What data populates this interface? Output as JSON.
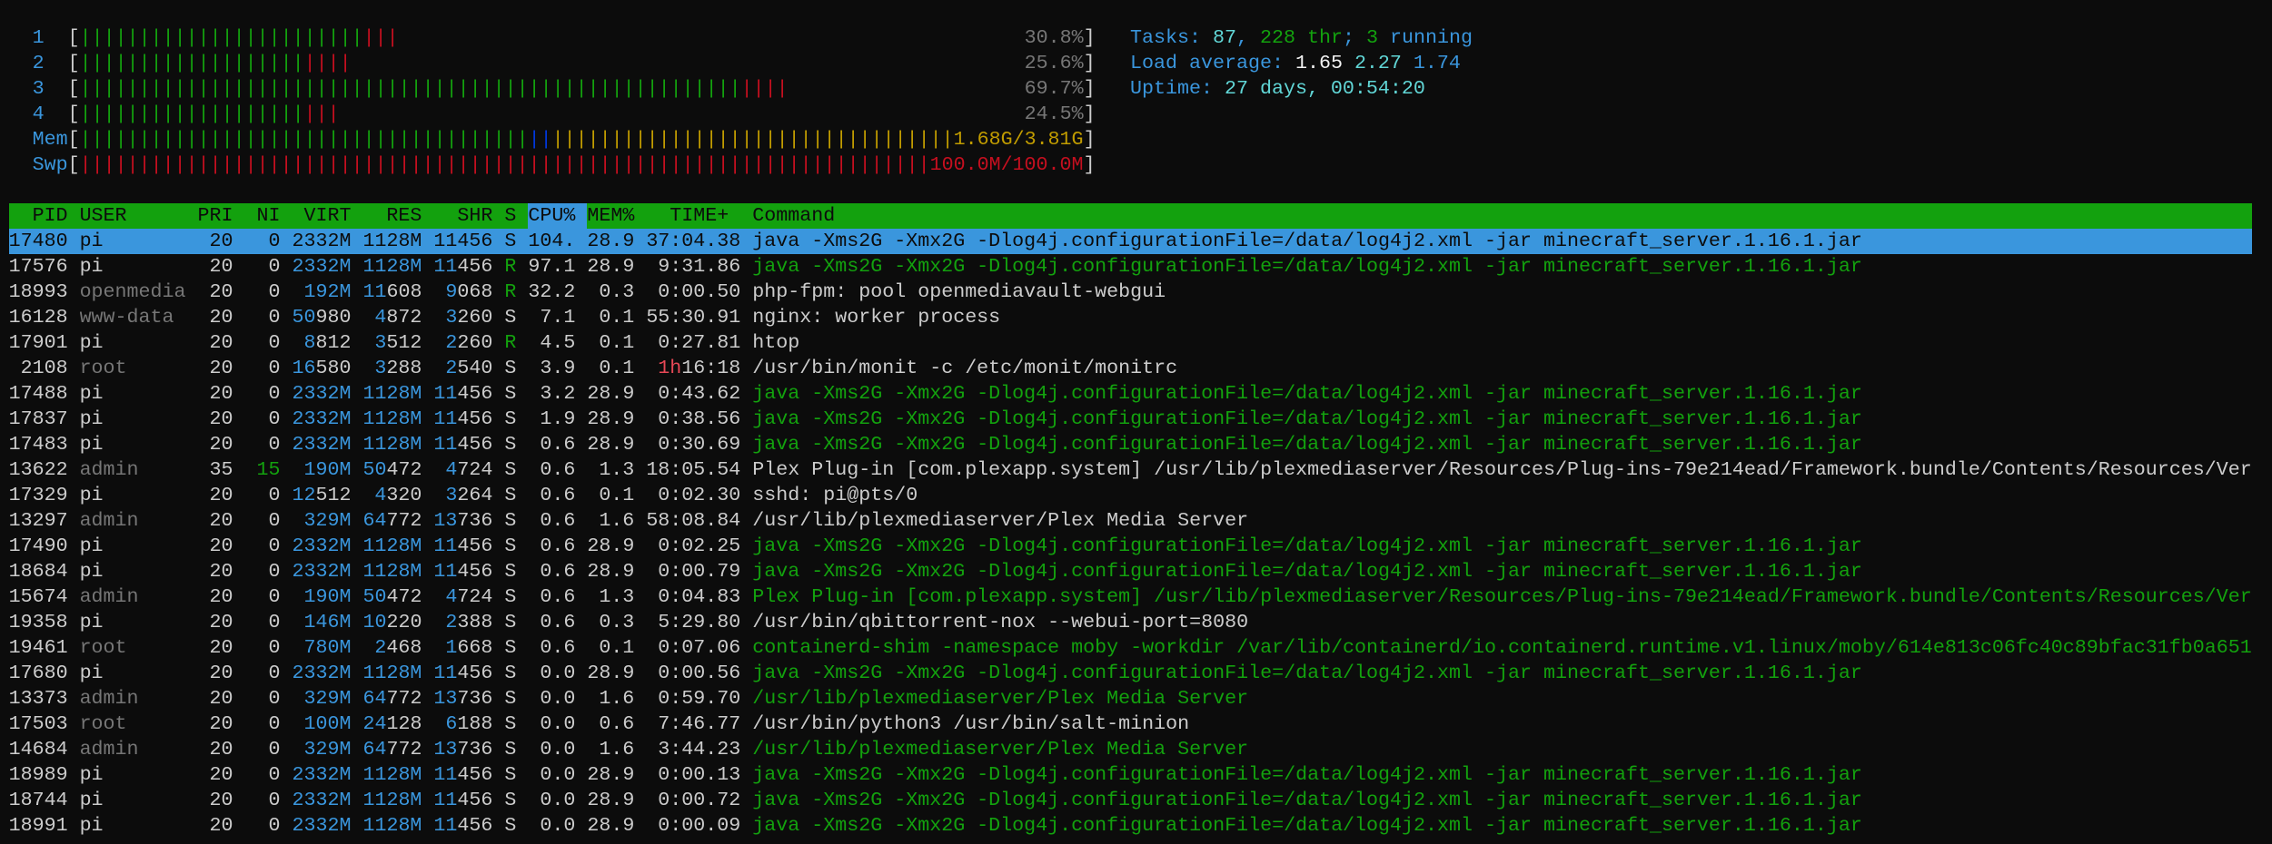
{
  "colors": {
    "green": "#13a10e",
    "red": "#c50f1f",
    "blue": "#3a96dd",
    "dark_blue": "#0037da",
    "yellow": "#c19c00",
    "cyan": "#61d6d6",
    "background": "#0c0c0c"
  },
  "meters": {
    "cpus": [
      {
        "label": "1",
        "value_text": "30.8%",
        "normal_pct": 28.2,
        "kernel_pct": 3.5
      },
      {
        "label": "2",
        "value_text": "25.6%",
        "normal_pct": 22.4,
        "kernel_pct": 4.7
      },
      {
        "label": "3",
        "value_text": "69.7%",
        "normal_pct": 65.9,
        "kernel_pct": 4.7
      },
      {
        "label": "4",
        "value_text": "24.5%",
        "normal_pct": 22.4,
        "kernel_pct": 3.5
      }
    ],
    "mem": {
      "label": "Mem",
      "value_text": "1.68G/3.81G",
      "used_pct": 44.7,
      "buffers_pct": 2.4,
      "cache_pct": 40.0
    },
    "swap": {
      "label": "Swp",
      "value_text": "100.0M/100.0M",
      "used_pct": 100
    }
  },
  "info": {
    "tasks_label": "Tasks: ",
    "tasks": "87",
    "sep1": ", ",
    "threads": "228",
    "thr_label": " thr",
    "sep2": "; ",
    "running": "3",
    "running_label": " running",
    "load_label": "Load average: ",
    "load1": "1.65",
    "load5": "2.27",
    "load15": "1.74",
    "uptime_label": "Uptime: ",
    "uptime": "27 days, 00:54:20"
  },
  "table": {
    "headers": {
      "pid": "PID",
      "user": "USER",
      "pri": "PRI",
      "ni": "NI",
      "virt": "VIRT",
      "res": "RES",
      "shr": "SHR",
      "s": "S",
      "cpu": "CPU%",
      "mem": "MEM%",
      "time": "TIME+",
      "command": "Command"
    },
    "sort_column": "cpu",
    "selected_index": 0,
    "rows": [
      {
        "pid": "17480",
        "user": "pi",
        "pri": "20",
        "ni": "0",
        "virt": "2332M",
        "res": "1128M",
        "shr": "11456",
        "s": "S",
        "cpu": "104.",
        "mem": "28.9",
        "time": "37:04.38",
        "command": "java -Xms2G -Xmx2G -Dlog4j.configurationFile=/data/log4j2.xml -jar minecraft_server.1.16.1.jar",
        "thread": false
      },
      {
        "pid": "17576",
        "user": "pi",
        "pri": "20",
        "ni": "0",
        "virt": "2332M",
        "res": "1128M",
        "shr": "11456",
        "s": "R",
        "cpu": "97.1",
        "mem": "28.9",
        "time": "9:31.86",
        "command": "java -Xms2G -Xmx2G -Dlog4j.configurationFile=/data/log4j2.xml -jar minecraft_server.1.16.1.jar",
        "thread": true
      },
      {
        "pid": "18993",
        "user": "openmedia",
        "pri": "20",
        "ni": "0",
        "virt": "192M",
        "res": "11608",
        "shr": "9068",
        "s": "R",
        "cpu": "32.2",
        "mem": "0.3",
        "time": "0:00.50",
        "command": "php-fpm: pool openmediavault-webgui",
        "thread": false
      },
      {
        "pid": "16128",
        "user": "www-data",
        "pri": "20",
        "ni": "0",
        "virt": "50980",
        "res": "4872",
        "shr": "3260",
        "s": "S",
        "cpu": "7.1",
        "mem": "0.1",
        "time": "55:30.91",
        "command": "nginx: worker process",
        "thread": false
      },
      {
        "pid": "17901",
        "user": "pi",
        "pri": "20",
        "ni": "0",
        "virt": "8812",
        "res": "3512",
        "shr": "2260",
        "s": "R",
        "cpu": "4.5",
        "mem": "0.1",
        "time": "0:27.81",
        "command": "htop",
        "thread": false
      },
      {
        "pid": "2108",
        "user": "root",
        "pri": "20",
        "ni": "0",
        "virt": "16580",
        "res": "3288",
        "shr": "2540",
        "s": "S",
        "cpu": "3.9",
        "mem": "0.1",
        "time": "1h16:18",
        "command": "/usr/bin/monit -c /etc/monit/monitrc",
        "thread": false
      },
      {
        "pid": "17488",
        "user": "pi",
        "pri": "20",
        "ni": "0",
        "virt": "2332M",
        "res": "1128M",
        "shr": "11456",
        "s": "S",
        "cpu": "3.2",
        "mem": "28.9",
        "time": "0:43.62",
        "command": "java -Xms2G -Xmx2G -Dlog4j.configurationFile=/data/log4j2.xml -jar minecraft_server.1.16.1.jar",
        "thread": true
      },
      {
        "pid": "17837",
        "user": "pi",
        "pri": "20",
        "ni": "0",
        "virt": "2332M",
        "res": "1128M",
        "shr": "11456",
        "s": "S",
        "cpu": "1.9",
        "mem": "28.9",
        "time": "0:38.56",
        "command": "java -Xms2G -Xmx2G -Dlog4j.configurationFile=/data/log4j2.xml -jar minecraft_server.1.16.1.jar",
        "thread": true
      },
      {
        "pid": "17483",
        "user": "pi",
        "pri": "20",
        "ni": "0",
        "virt": "2332M",
        "res": "1128M",
        "shr": "11456",
        "s": "S",
        "cpu": "0.6",
        "mem": "28.9",
        "time": "0:30.69",
        "command": "java -Xms2G -Xmx2G -Dlog4j.configurationFile=/data/log4j2.xml -jar minecraft_server.1.16.1.jar",
        "thread": true
      },
      {
        "pid": "13622",
        "user": "admin",
        "pri": "35",
        "ni": "15",
        "virt": "190M",
        "res": "50472",
        "shr": "4724",
        "s": "S",
        "cpu": "0.6",
        "mem": "1.3",
        "time": "18:05.54",
        "command": "Plex Plug-in [com.plexapp.system] /usr/lib/plexmediaserver/Resources/Plug-ins-79e214ead/Framework.bundle/Contents/Resources/Ver",
        "thread": false
      },
      {
        "pid": "17329",
        "user": "pi",
        "pri": "20",
        "ni": "0",
        "virt": "12512",
        "res": "4320",
        "shr": "3264",
        "s": "S",
        "cpu": "0.6",
        "mem": "0.1",
        "time": "0:02.30",
        "command": "sshd: pi@pts/0",
        "thread": false
      },
      {
        "pid": "13297",
        "user": "admin",
        "pri": "20",
        "ni": "0",
        "virt": "329M",
        "res": "64772",
        "shr": "13736",
        "s": "S",
        "cpu": "0.6",
        "mem": "1.6",
        "time": "58:08.84",
        "command": "/usr/lib/plexmediaserver/Plex Media Server",
        "thread": false
      },
      {
        "pid": "17490",
        "user": "pi",
        "pri": "20",
        "ni": "0",
        "virt": "2332M",
        "res": "1128M",
        "shr": "11456",
        "s": "S",
        "cpu": "0.6",
        "mem": "28.9",
        "time": "0:02.25",
        "command": "java -Xms2G -Xmx2G -Dlog4j.configurationFile=/data/log4j2.xml -jar minecraft_server.1.16.1.jar",
        "thread": true
      },
      {
        "pid": "18684",
        "user": "pi",
        "pri": "20",
        "ni": "0",
        "virt": "2332M",
        "res": "1128M",
        "shr": "11456",
        "s": "S",
        "cpu": "0.6",
        "mem": "28.9",
        "time": "0:00.79",
        "command": "java -Xms2G -Xmx2G -Dlog4j.configurationFile=/data/log4j2.xml -jar minecraft_server.1.16.1.jar",
        "thread": true
      },
      {
        "pid": "15674",
        "user": "admin",
        "pri": "20",
        "ni": "0",
        "virt": "190M",
        "res": "50472",
        "shr": "4724",
        "s": "S",
        "cpu": "0.6",
        "mem": "1.3",
        "time": "0:04.83",
        "command": "Plex Plug-in [com.plexapp.system] /usr/lib/plexmediaserver/Resources/Plug-ins-79e214ead/Framework.bundle/Contents/Resources/Ver",
        "thread": true
      },
      {
        "pid": "19358",
        "user": "pi",
        "pri": "20",
        "ni": "0",
        "virt": "146M",
        "res": "10220",
        "shr": "2388",
        "s": "S",
        "cpu": "0.6",
        "mem": "0.3",
        "time": "5:29.80",
        "command": "/usr/bin/qbittorrent-nox --webui-port=8080",
        "thread": false
      },
      {
        "pid": "19461",
        "user": "root",
        "pri": "20",
        "ni": "0",
        "virt": "780M",
        "res": "2468",
        "shr": "1668",
        "s": "S",
        "cpu": "0.6",
        "mem": "0.1",
        "time": "0:07.06",
        "command": "containerd-shim -namespace moby -workdir /var/lib/containerd/io.containerd.runtime.v1.linux/moby/614e813c06fc40c89bfac31fb0a651",
        "thread": true
      },
      {
        "pid": "17680",
        "user": "pi",
        "pri": "20",
        "ni": "0",
        "virt": "2332M",
        "res": "1128M",
        "shr": "11456",
        "s": "S",
        "cpu": "0.0",
        "mem": "28.9",
        "time": "0:00.56",
        "command": "java -Xms2G -Xmx2G -Dlog4j.configurationFile=/data/log4j2.xml -jar minecraft_server.1.16.1.jar",
        "thread": true
      },
      {
        "pid": "13373",
        "user": "admin",
        "pri": "20",
        "ni": "0",
        "virt": "329M",
        "res": "64772",
        "shr": "13736",
        "s": "S",
        "cpu": "0.0",
        "mem": "1.6",
        "time": "0:59.70",
        "command": "/usr/lib/plexmediaserver/Plex Media Server",
        "thread": true
      },
      {
        "pid": "17503",
        "user": "root",
        "pri": "20",
        "ni": "0",
        "virt": "100M",
        "res": "24128",
        "shr": "6188",
        "s": "S",
        "cpu": "0.0",
        "mem": "0.6",
        "time": "7:46.77",
        "command": "/usr/bin/python3 /usr/bin/salt-minion",
        "thread": false
      },
      {
        "pid": "14684",
        "user": "admin",
        "pri": "20",
        "ni": "0",
        "virt": "329M",
        "res": "64772",
        "shr": "13736",
        "s": "S",
        "cpu": "0.0",
        "mem": "1.6",
        "time": "3:44.23",
        "command": "/usr/lib/plexmediaserver/Plex Media Server",
        "thread": true
      },
      {
        "pid": "18989",
        "user": "pi",
        "pri": "20",
        "ni": "0",
        "virt": "2332M",
        "res": "1128M",
        "shr": "11456",
        "s": "S",
        "cpu": "0.0",
        "mem": "28.9",
        "time": "0:00.13",
        "command": "java -Xms2G -Xmx2G -Dlog4j.configurationFile=/data/log4j2.xml -jar minecraft_server.1.16.1.jar",
        "thread": true
      },
      {
        "pid": "18744",
        "user": "pi",
        "pri": "20",
        "ni": "0",
        "virt": "2332M",
        "res": "1128M",
        "shr": "11456",
        "s": "S",
        "cpu": "0.0",
        "mem": "28.9",
        "time": "0:00.72",
        "command": "java -Xms2G -Xmx2G -Dlog4j.configurationFile=/data/log4j2.xml -jar minecraft_server.1.16.1.jar",
        "thread": true
      },
      {
        "pid": "18991",
        "user": "pi",
        "pri": "20",
        "ni": "0",
        "virt": "2332M",
        "res": "1128M",
        "shr": "11456",
        "s": "S",
        "cpu": "0.0",
        "mem": "28.9",
        "time": "0:00.09",
        "command": "java -Xms2G -Xmx2G -Dlog4j.configurationFile=/data/log4j2.xml -jar minecraft_server.1.16.1.jar",
        "thread": true
      }
    ]
  }
}
